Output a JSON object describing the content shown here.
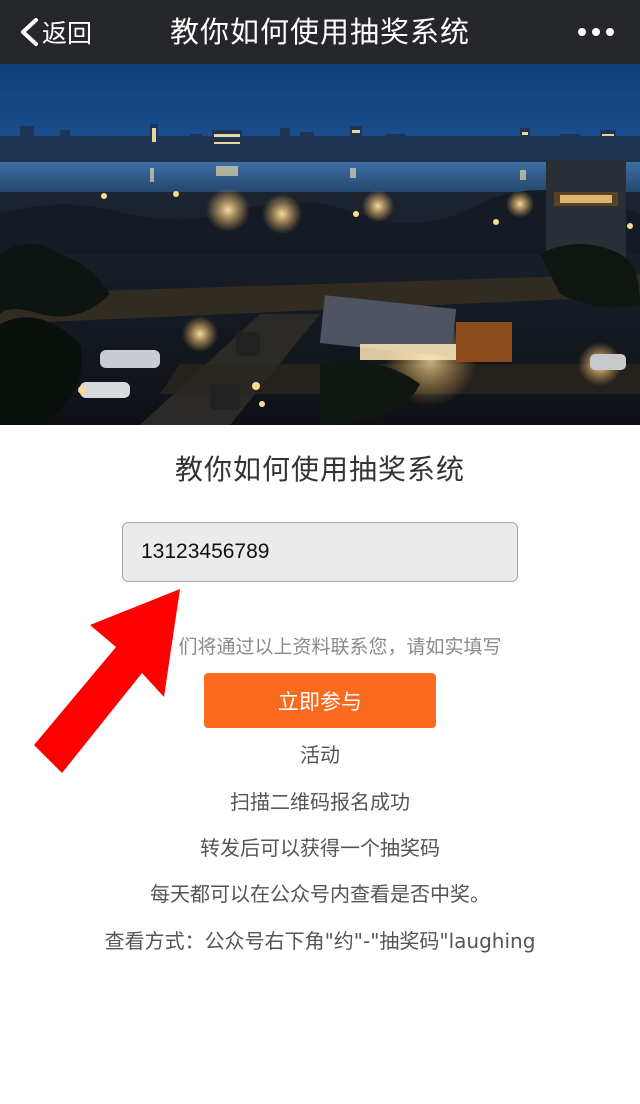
{
  "nav": {
    "back_label": "返回",
    "title": "教你如何使用抽奖系统",
    "more_icon": "more-dots-icon",
    "bg_color": "#26272b"
  },
  "hero": {
    "image": "night-city-river-photo"
  },
  "main": {
    "title": "教你如何使用抽奖系统",
    "phone_input_value": "13123456789",
    "hint": "们将通过以上资料联系您，请如实填写",
    "join_button_label": "立即参与",
    "join_button_color": "#fa6a1f",
    "info_lines": [
      "活动",
      "扫描二维码报名成功",
      "转发后可以获得一个抽奖码",
      "每天都可以在公众号内查看是否中奖。",
      "查看方式：公众号右下角\"约\"-\"抽奖码\"laughing"
    ]
  },
  "annotation": {
    "arrow_color": "#ff0000",
    "arrow_icon": "red-arrow-icon"
  }
}
